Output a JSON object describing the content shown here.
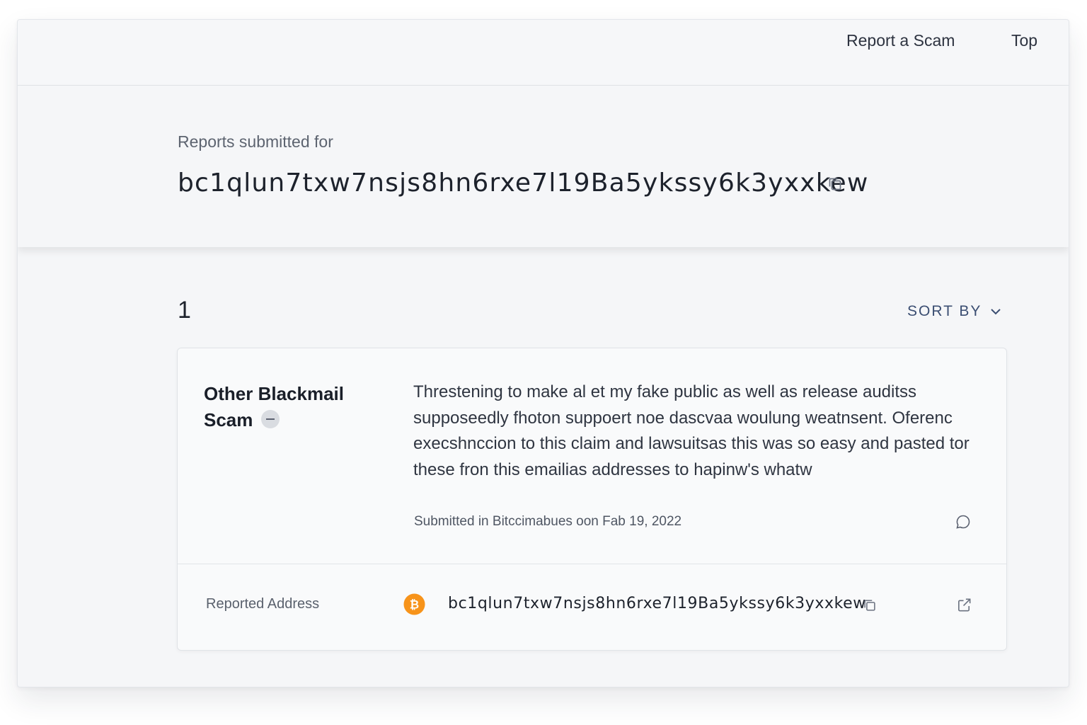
{
  "nav": {
    "report_label": "Report a Scam",
    "top_label": "Top"
  },
  "header": {
    "subtitle": "Reports submitted for",
    "address": "bc1qlun7txw7nsjs8hn6rxe7l19Ba5ykssy6k3yxxkew"
  },
  "results": {
    "count": "1",
    "sort_label": "SORT BY"
  },
  "report": {
    "scam_type": "Other Blackmail Scam",
    "description": "Threstening to make al et my fake public as well as release auditss supposeedly fhoton suppoert noe dascvaa woulung weatnsent. Oferenc execshnccion to this claim and lawsuitsas this was so easy and pasted tor these fron this emailias addresses to hapinw's whatw",
    "submitted": "Submitted in Bitccimabues oon Fab 19, 2022",
    "reported_label": "Reported Address",
    "reported_address": "bc1qlun7txw7nsjs8hn6rxe7l19Ba5ykssy6k3yxxkew",
    "coin_icon": "bitcoin-icon",
    "coin_color": "#f7931a"
  },
  "colors": {
    "accent": "#3b4e72",
    "background": "#f5f6f8",
    "card": "#f9fafb"
  }
}
